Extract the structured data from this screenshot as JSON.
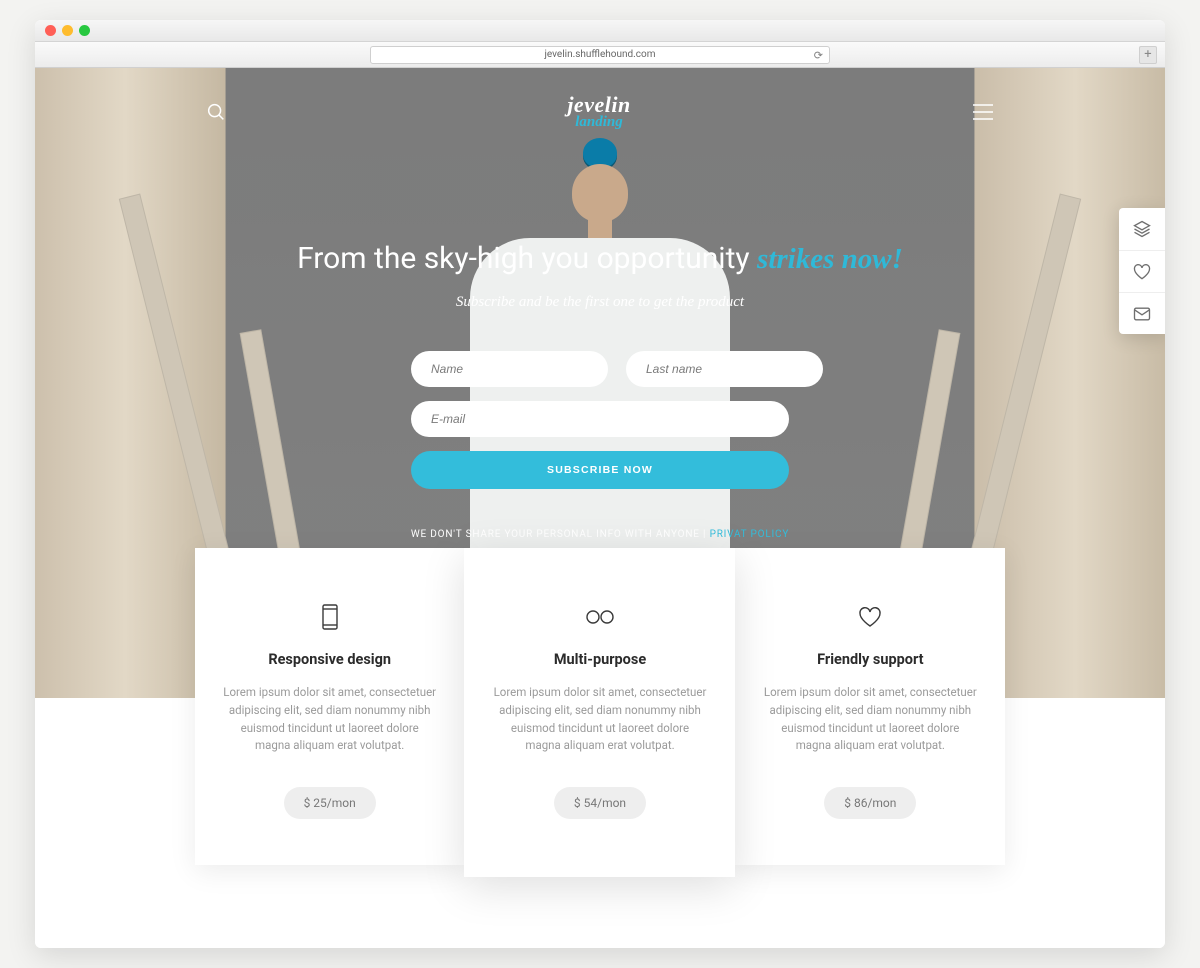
{
  "browser": {
    "url": "jevelin.shufflehound.com"
  },
  "logo": {
    "line1": "jevelin",
    "line2": "landing"
  },
  "headline": {
    "plain": "From the sky-high you opportunity ",
    "emphasis": "strikes now!"
  },
  "subheadline": "Subscribe and be the first one to get the product",
  "form": {
    "name_placeholder": "Name",
    "lastname_placeholder": "Last name",
    "email_placeholder": "E-mail",
    "submit_label": "SUBSCRIBE NOW"
  },
  "disclaimer": {
    "text": "WE DON'T SHARE YOUR PERSONAL INFO WITH ANYONE",
    "sep": "   |   ",
    "link": "PRIVAT POLICY"
  },
  "features": [
    {
      "title": "Responsive design",
      "body": "Lorem ipsum dolor sit amet, consectetuer adipiscing elit, sed diam nonummy nibh euismod tincidunt ut laoreet dolore magna aliquam erat volutpat.",
      "price": "$ 25/mon"
    },
    {
      "title": "Multi-purpose",
      "body": "Lorem ipsum dolor sit amet, consectetuer adipiscing elit, sed diam nonummy nibh euismod tincidunt ut laoreet dolore magna aliquam erat volutpat.",
      "price": "$ 54/mon"
    },
    {
      "title": "Friendly support",
      "body": "Lorem ipsum dolor sit amet, consectetuer adipiscing elit, sed diam nonummy nibh euismod tincidunt ut laoreet dolore magna aliquam erat volutpat.",
      "price": "$ 86/mon"
    }
  ]
}
